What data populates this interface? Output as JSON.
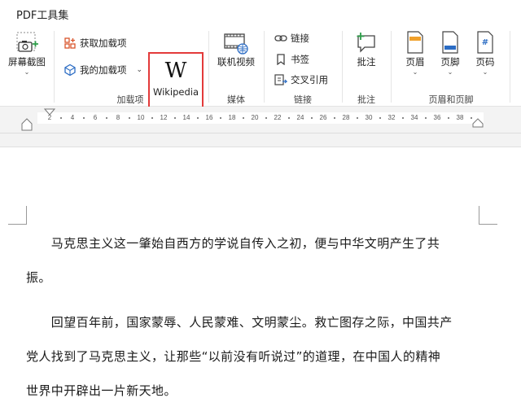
{
  "tabbar": {
    "title": "PDF工具集"
  },
  "ribbon": {
    "screenshot": {
      "label": "屏幕截图"
    },
    "addins": {
      "get": "获取加载项",
      "mine": "我的加载项",
      "group": "加载项"
    },
    "wikipedia": {
      "label": "Wikipedia",
      "glyph": "W"
    },
    "media": {
      "online_video": "联机视频",
      "group": "媒体"
    },
    "links": {
      "link": "链接",
      "bookmark": "书签",
      "crossref": "交叉引用",
      "group": "链接"
    },
    "comments": {
      "comment": "批注",
      "group": "批注"
    },
    "headerfooter": {
      "header": "页眉",
      "footer": "页脚",
      "pagenum": "页码",
      "group": "页眉和页脚"
    }
  },
  "ruler": {
    "ticks": [
      "2",
      "4",
      "6",
      "8",
      "10",
      "12",
      "14",
      "16",
      "18",
      "20",
      "22",
      "24",
      "26",
      "28",
      "30",
      "32",
      "34",
      "36",
      "38"
    ]
  },
  "document": {
    "paragraphs": [
      [
        "　　马克思主义这一肇始自西方的学说自传入之初，便与中华文明产生了共",
        "振。"
      ],
      [
        "　　回望百年前，国家蒙辱、人民蒙难、文明蒙尘。救亡图存之际，中国共产",
        "党人找到了马克思主义，让那些“以前没有听说过”的道理，在中国人的精神",
        "世界中开辟出一片新天地。"
      ]
    ]
  },
  "colors": {
    "highlight": "#e33a3a",
    "accent_green": "#2e9e4a",
    "accent_blue": "#2b6cc4"
  }
}
